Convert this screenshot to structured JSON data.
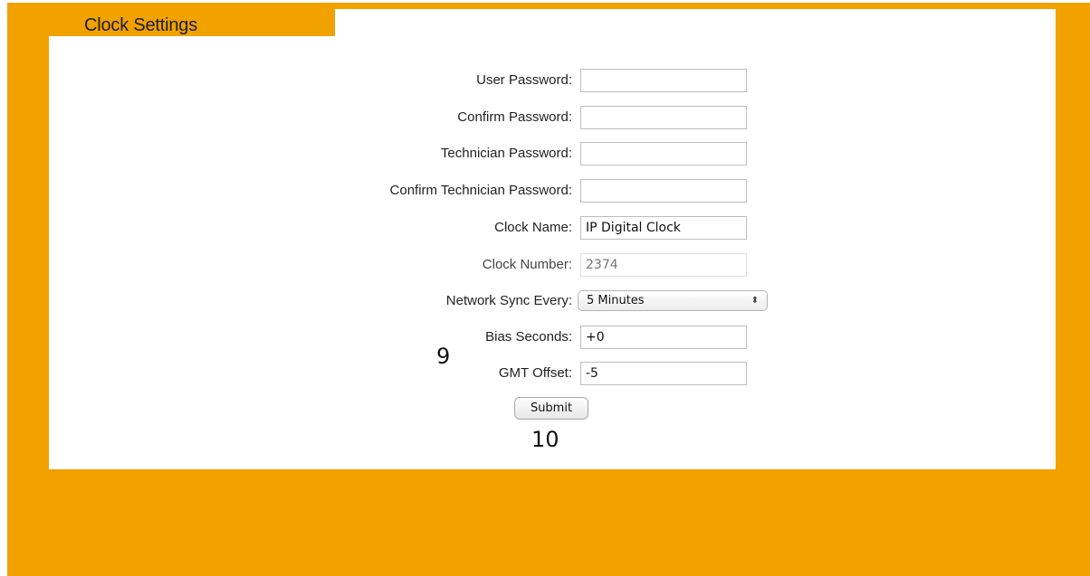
{
  "page": {
    "title": "Clock Settings"
  },
  "form": {
    "user_password": {
      "label": "User Password:",
      "value": ""
    },
    "confirm_password": {
      "label": "Confirm Password:",
      "value": ""
    },
    "technician_password": {
      "label": "Technician Password:",
      "value": ""
    },
    "confirm_technician_password": {
      "label": "Confirm Technician Password:",
      "value": ""
    },
    "clock_name": {
      "label": "Clock Name:",
      "value": "IP Digital Clock"
    },
    "clock_number": {
      "label": "Clock Number:",
      "value": "2374"
    },
    "network_sync": {
      "label": "Network Sync Every:",
      "selected": "5 Minutes"
    },
    "bias_seconds": {
      "label": "Bias Seconds:",
      "value": "+0"
    },
    "gmt_offset": {
      "label": "GMT Offset:",
      "value": "-5"
    },
    "submit_label": "Submit"
  },
  "annotations": {
    "marker_9": "9",
    "marker_10": "10"
  },
  "colors": {
    "frame": "#f1a100",
    "panel": "#ffffff"
  }
}
